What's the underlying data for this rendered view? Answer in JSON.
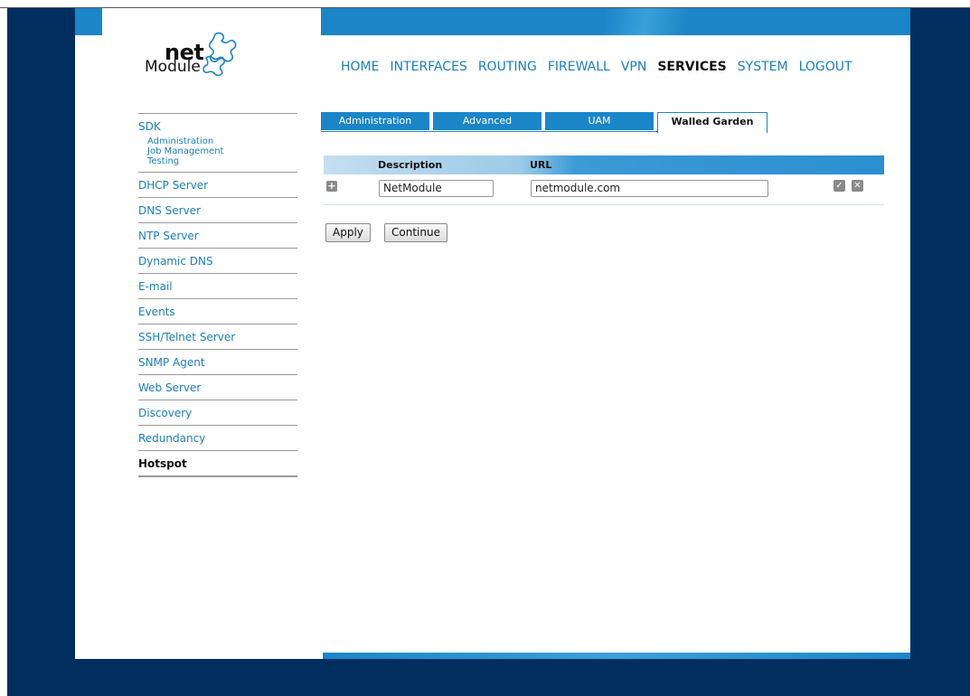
{
  "logo": {
    "net": "net",
    "module": "Module"
  },
  "nav": [
    "HOME",
    "INTERFACES",
    "ROUTING",
    "FIREWALL",
    "VPN",
    "SERVICES",
    "SYSTEM",
    "LOGOUT"
  ],
  "nav_active": "SERVICES",
  "sidebar": {
    "sdk": {
      "label": "SDK",
      "subitems": [
        "Administration",
        "Job Management",
        "Testing"
      ]
    },
    "items": [
      "DHCP Server",
      "DNS Server",
      "NTP Server",
      "Dynamic DNS",
      "E-mail",
      "Events",
      "SSH/Telnet Server",
      "SNMP Agent",
      "Web Server",
      "Discovery",
      "Redundancy",
      "Hotspot"
    ],
    "active": "Hotspot"
  },
  "tabs": [
    "Administration",
    "Advanced",
    "UAM",
    "Walled Garden"
  ],
  "tab_active": "Walled Garden",
  "table": {
    "headers": {
      "description": "Description",
      "url": "URL"
    },
    "rows": [
      {
        "description": "NetModule",
        "url": "netmodule.com"
      }
    ]
  },
  "buttons": {
    "apply": "Apply",
    "continue": "Continue"
  },
  "colors": {
    "brand_blue": "#1a86c8",
    "background_navy": "#002f5f",
    "link_blue": "#1a7fc2"
  },
  "icons": {
    "add": "plus-icon",
    "save": "check-icon",
    "delete": "close-icon"
  }
}
